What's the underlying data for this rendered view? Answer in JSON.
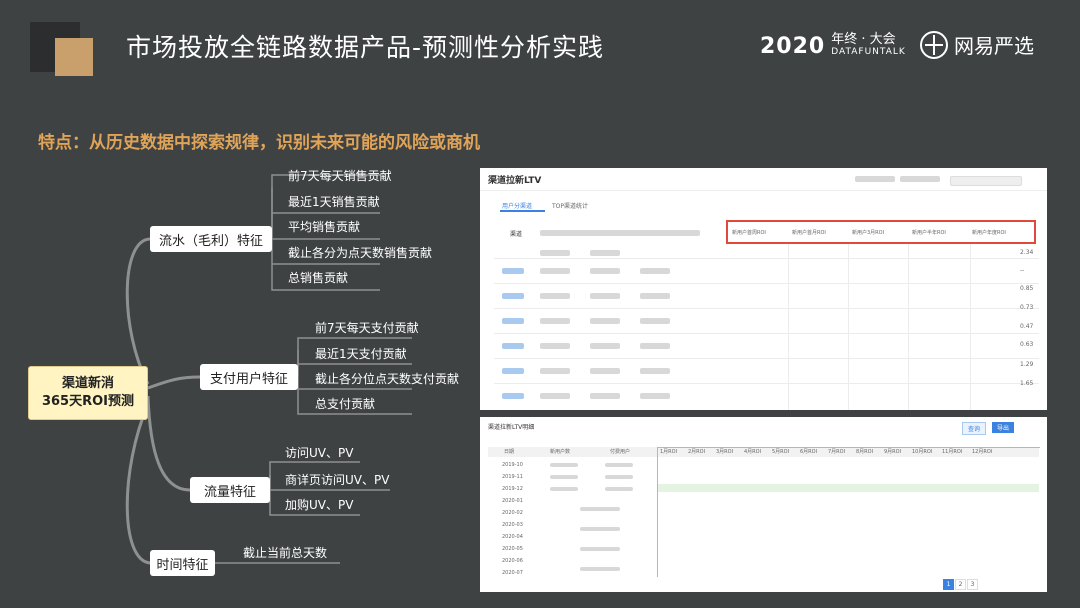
{
  "header": {
    "title": "市场投放全链路数据产品-预测性分析实践",
    "brand_year": "2020",
    "brand_event": "年终 · 大会",
    "brand_sub": "DATAFUNTALK",
    "company": "网易严选"
  },
  "subtitle": "特点：从历史数据中探索规律，识别未来可能的风险或商机",
  "mindmap": {
    "root_line1": "渠道新消",
    "root_line2": "365天ROI预测",
    "branches": [
      {
        "label": "流水（毛利）特征",
        "leaves": [
          "前7天每天销售贡献",
          "最近1天销售贡献",
          "平均销售贡献",
          "截止各分为点天数销售贡献",
          "总销售贡献"
        ]
      },
      {
        "label": "支付用户特征",
        "leaves": [
          "前7天每天支付贡献",
          "最近1天支付贡献",
          "截止各分位点天数支付贡献",
          "总支付贡献"
        ]
      },
      {
        "label": "流量特征",
        "leaves": [
          "访问UV、PV",
          "商详页访问UV、PV",
          "加购UV、PV"
        ]
      },
      {
        "label": "时间特征",
        "leaves": [
          "截止当前总天数"
        ]
      }
    ]
  },
  "screenshot1": {
    "title": "渠道拉新LTV",
    "tab_active": "用户分渠道",
    "tab2": "TOP渠道统计",
    "col_channel": "渠道",
    "highlight_cols": [
      "新用户首周ROI",
      "新用户首月ROI",
      "新用户3月ROI",
      "新用户半年ROI",
      "新用户年度ROI"
    ],
    "right_values": [
      "2.34",
      "--",
      "0.85",
      "0.73",
      "0.47",
      "0.63",
      "1.29",
      "1.65"
    ]
  },
  "screenshot2": {
    "title": "渠道拉新LTV明细",
    "btn_query": "查询",
    "btn_export": "导出",
    "cols": [
      "日期",
      "新用户数",
      "付费用户",
      "1月ROI",
      "2月ROI",
      "3月ROI",
      "4月ROI",
      "5月ROI",
      "6月ROI",
      "7月ROI",
      "8月ROI",
      "9月ROI",
      "10月ROI",
      "11月ROI",
      "12月ROI"
    ],
    "dates": [
      "2019-10",
      "2019-11",
      "2019-12",
      "2020-01",
      "2020-02",
      "2020-03",
      "2020-04",
      "2020-05",
      "2020-06",
      "2020-07"
    ],
    "pages": [
      "1",
      "2",
      "3"
    ]
  }
}
